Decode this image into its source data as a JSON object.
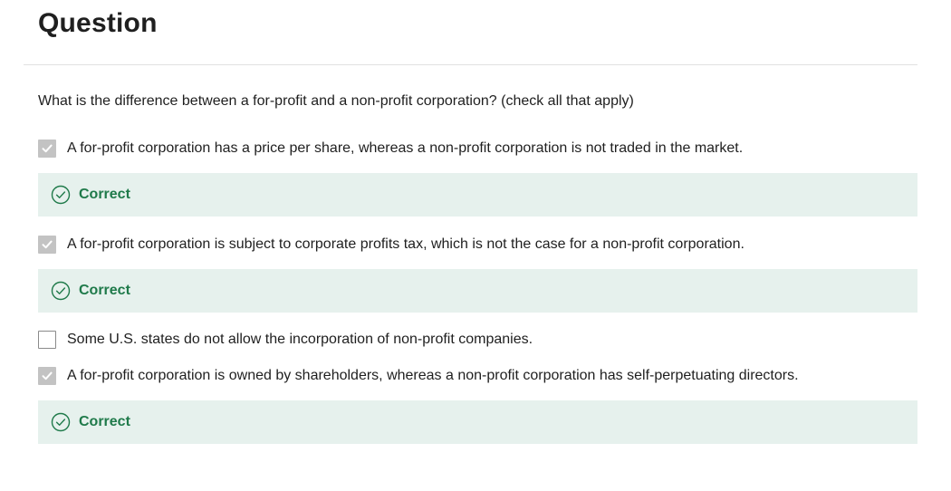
{
  "question": {
    "heading": "Question",
    "prompt": "What is the difference between a for-profit and a non-profit corporation? (check all that apply)"
  },
  "options": [
    {
      "label": "A for-profit corporation has a price per share, whereas a non-profit corporation is not traded in the market.",
      "checked": true,
      "feedback": "Correct"
    },
    {
      "label": "A for-profit corporation is subject to corporate profits tax, which is not the case for a non-profit corporation.",
      "checked": true,
      "feedback": "Correct"
    },
    {
      "label": "Some U.S. states do not allow the incorporation of non-profit companies.",
      "checked": false
    },
    {
      "label": "A for-profit corporation is owned by shareholders, whereas a non-profit corporation has self-perpetuating directors.",
      "checked": true,
      "feedback": "Correct"
    }
  ],
  "icons": {
    "checkbox_checked": "checkmark-icon",
    "feedback_correct": "check-circle-icon"
  },
  "colors": {
    "feedback_background": "#e6f1ed",
    "feedback_text": "#1f7a4a",
    "checkbox_checked": "#c3c3c3"
  }
}
